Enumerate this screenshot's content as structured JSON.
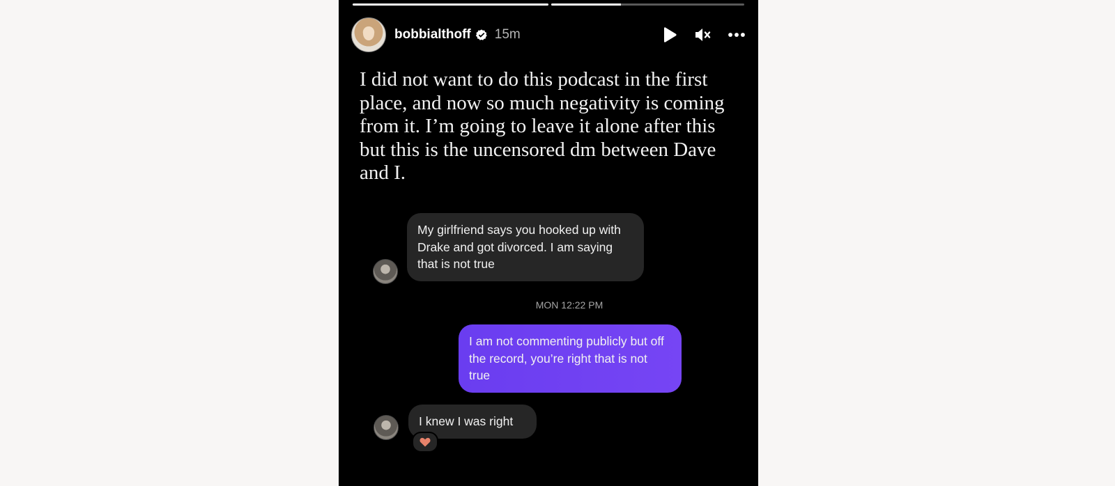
{
  "story": {
    "progress": [
      1.0,
      0.36
    ],
    "username": "bobbialthoff",
    "verified": true,
    "time_ago": "15m",
    "icons": {
      "play": "play-icon",
      "mute": "mute-icon",
      "more": "more-icon",
      "verified": "verified-badge-icon"
    },
    "caption": "I did not want to do this podcast in the first place, and now so much negativity is coming from it. I’m going to leave it alone after this but this is the uncensored dm between Dave and I."
  },
  "dm": {
    "messages": [
      {
        "direction": "incoming",
        "text": "My girlfriend says you hooked up with Drake and got divorced.  I am saying that is not true"
      },
      {
        "direction": "outgoing",
        "text": "I am not commenting publicly but off the record, you’re right that is not true"
      },
      {
        "direction": "incoming",
        "text": "I knew I was right",
        "reaction": "❤️"
      }
    ],
    "timestamp": "MON 12:22 PM"
  },
  "colors": {
    "background": "#f8f6f5",
    "story_bg": "#000000",
    "incoming_bubble": "#262626",
    "outgoing_bubble": "#6e3ff3",
    "reaction_heart": "#e8836b"
  }
}
